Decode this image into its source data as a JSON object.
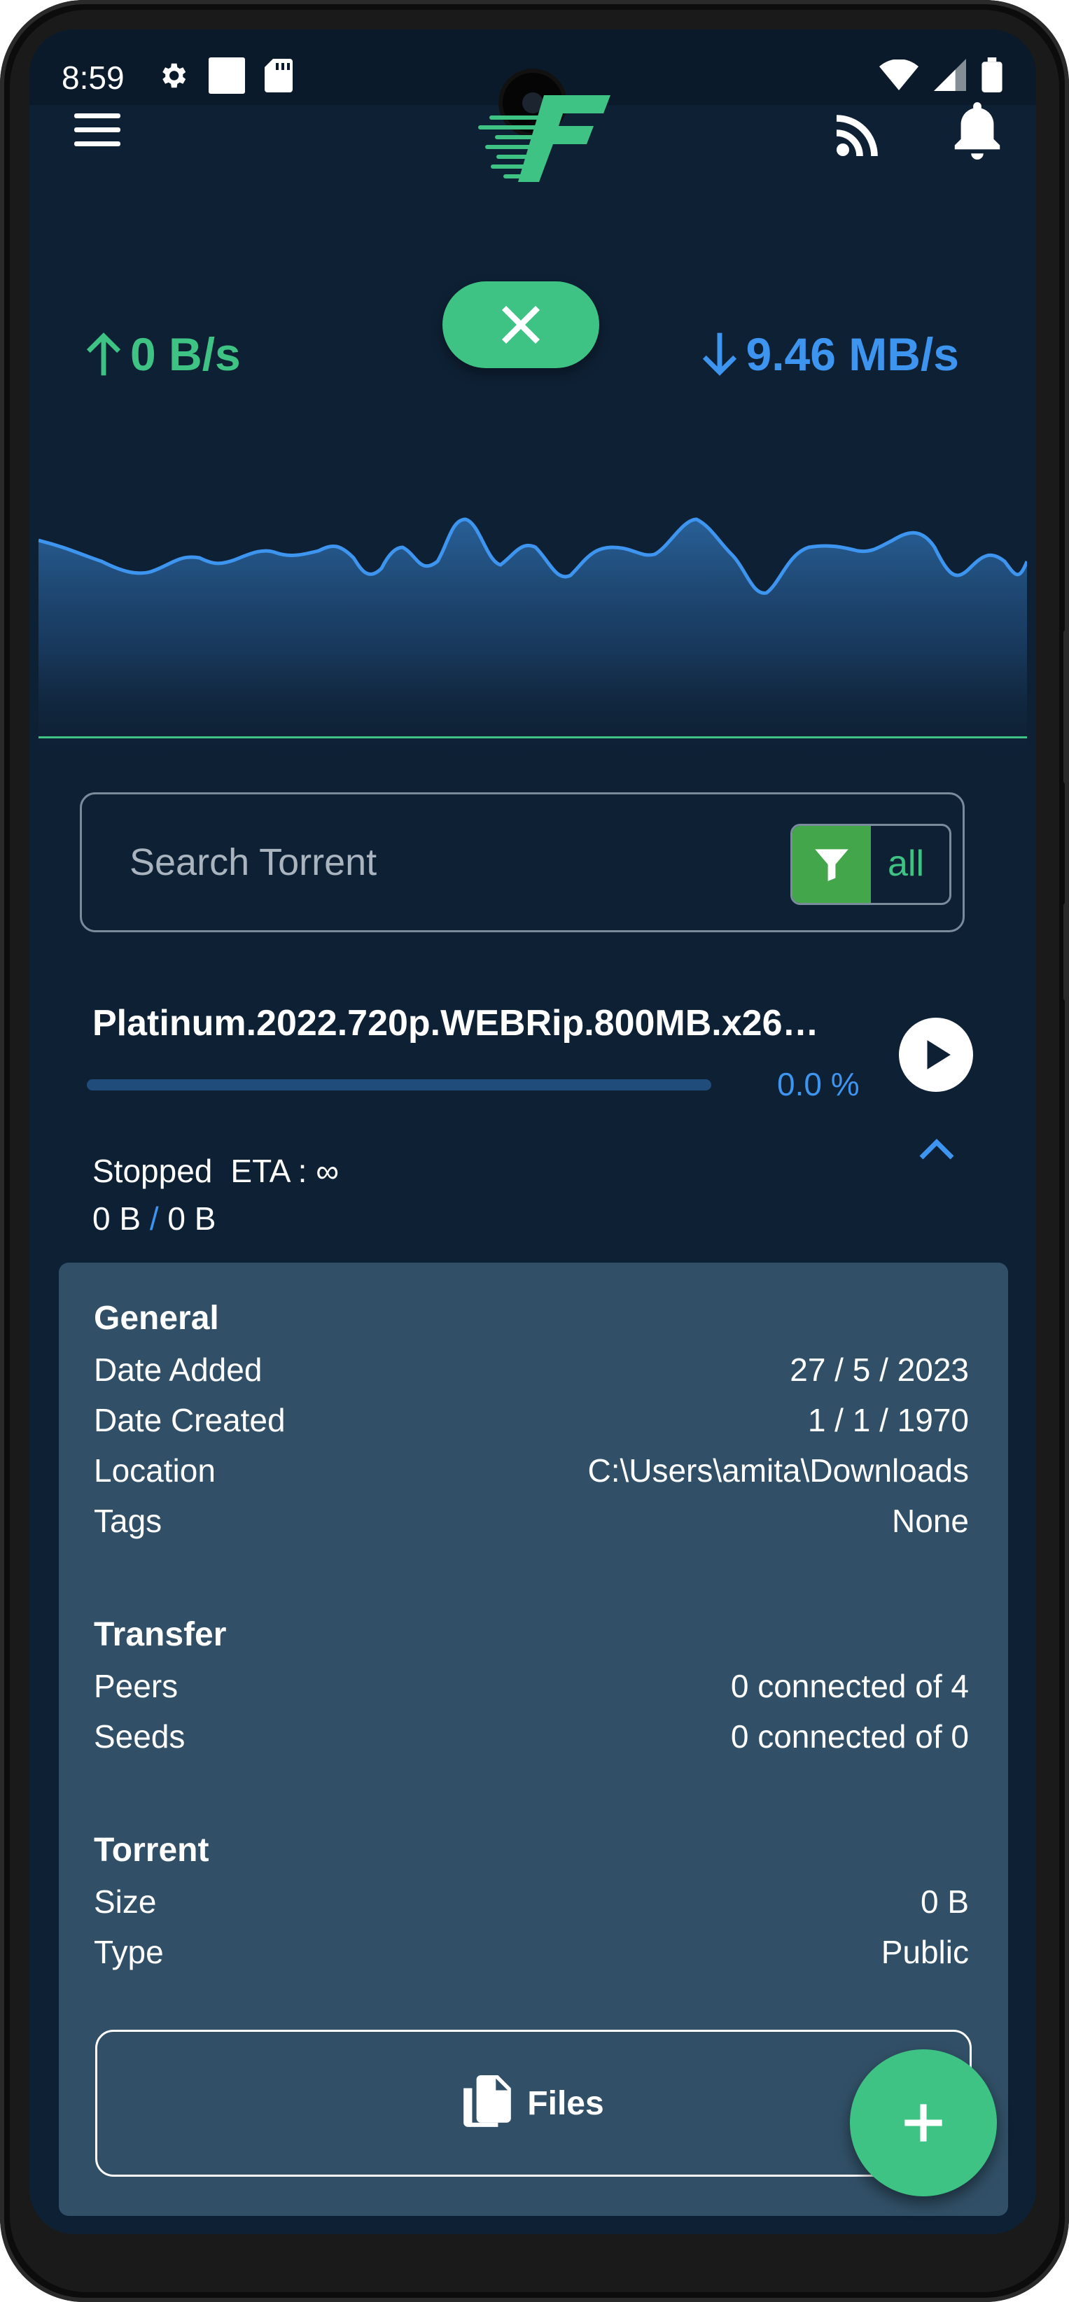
{
  "status_bar": {
    "time": "8:59"
  },
  "speeds": {
    "upload": "0 B/s",
    "download": "9.46 MB/s"
  },
  "search": {
    "placeholder": "Search Torrent",
    "filter_label": "all"
  },
  "torrent": {
    "name": "Platinum.2022.720p.WEBRip.800MB.x26…",
    "progress_percent_text": "0.0 %",
    "progress_fraction": 0.0,
    "state": "Stopped",
    "eta": "ETA : ∞",
    "downloaded": "0 B",
    "separator": "/",
    "total": "0 B"
  },
  "details": {
    "general": {
      "title": "General",
      "rows": [
        {
          "label": "Date Added",
          "value": "27 / 5 / 2023"
        },
        {
          "label": "Date Created",
          "value": "1 / 1 / 1970"
        },
        {
          "label": "Location",
          "value": "C:\\Users\\amita\\Downloads"
        },
        {
          "label": "Tags",
          "value": "None"
        }
      ]
    },
    "transfer": {
      "title": "Transfer",
      "rows": [
        {
          "label": "Peers",
          "value": "0 connected of 4"
        },
        {
          "label": "Seeds",
          "value": "0 connected of 0"
        }
      ]
    },
    "torrent": {
      "title": "Torrent",
      "rows": [
        {
          "label": "Size",
          "value": "0 B"
        },
        {
          "label": "Type",
          "value": "Public"
        }
      ]
    },
    "files_button": "Files"
  },
  "colors": {
    "accent_green": "#3ec384",
    "accent_blue": "#3d95f0",
    "background": "#0e2034",
    "panel": "#315067"
  },
  "icons": [
    "menu-icon",
    "logo-icon",
    "cast-icon",
    "bell-icon",
    "arrow-up-icon",
    "close-icon",
    "arrow-down-icon",
    "filter-icon",
    "play-icon",
    "chevron-up-icon",
    "files-icon",
    "plus-icon"
  ]
}
